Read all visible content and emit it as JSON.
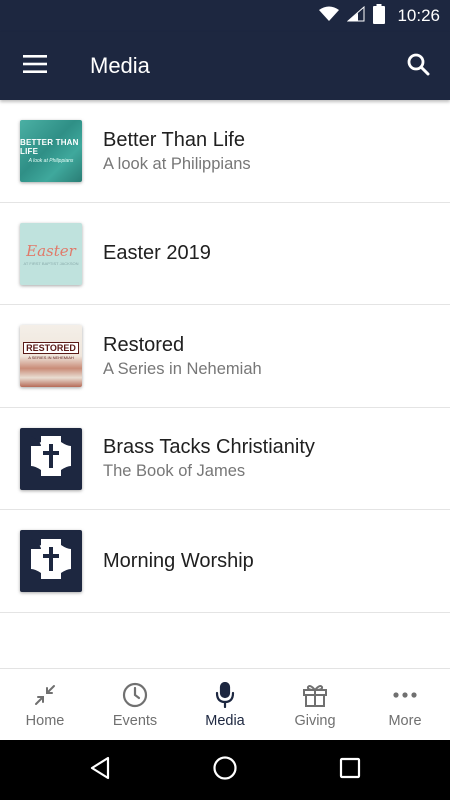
{
  "status_bar": {
    "time": "10:26",
    "icons": [
      "wifi-icon",
      "signal-icon",
      "battery-icon"
    ]
  },
  "app_bar": {
    "title": "Media",
    "menu_icon": "hamburger-menu-icon",
    "search_icon": "search-icon"
  },
  "media_items": [
    {
      "title": "Better Than Life",
      "subtitle": "A look at Philippians",
      "thumb": {
        "line1": "BETTER THAN LIFE",
        "line2": "A look at Philippians"
      }
    },
    {
      "title": "Easter 2019",
      "subtitle": "",
      "thumb": {
        "line1": "Easter",
        "line2": "AT FIRST BAPTIST JACKSON"
      }
    },
    {
      "title": "Restored",
      "subtitle": "A Series in Nehemiah",
      "thumb": {
        "line1": "RESTORED",
        "line2": "A SERIES IN NEHEMIAH"
      }
    },
    {
      "title": "Brass Tacks Christianity",
      "subtitle": "The Book of James",
      "thumb": {
        "icon": "church-cross-logo-icon"
      }
    },
    {
      "title": "Morning Worship",
      "subtitle": "",
      "thumb": {
        "icon": "church-cross-logo-icon"
      }
    }
  ],
  "bottom_nav": [
    {
      "label": "Home",
      "icon": "collapse-arrows-icon",
      "active": false
    },
    {
      "label": "Events",
      "icon": "clock-icon",
      "active": false
    },
    {
      "label": "Media",
      "icon": "microphone-icon",
      "active": true
    },
    {
      "label": "Giving",
      "icon": "gift-icon",
      "active": false
    },
    {
      "label": "More",
      "icon": "more-dots-icon",
      "active": false
    }
  ],
  "colors": {
    "primary": "#1d2740",
    "active_nav": "#1d2740",
    "inactive_nav": "#707070"
  }
}
